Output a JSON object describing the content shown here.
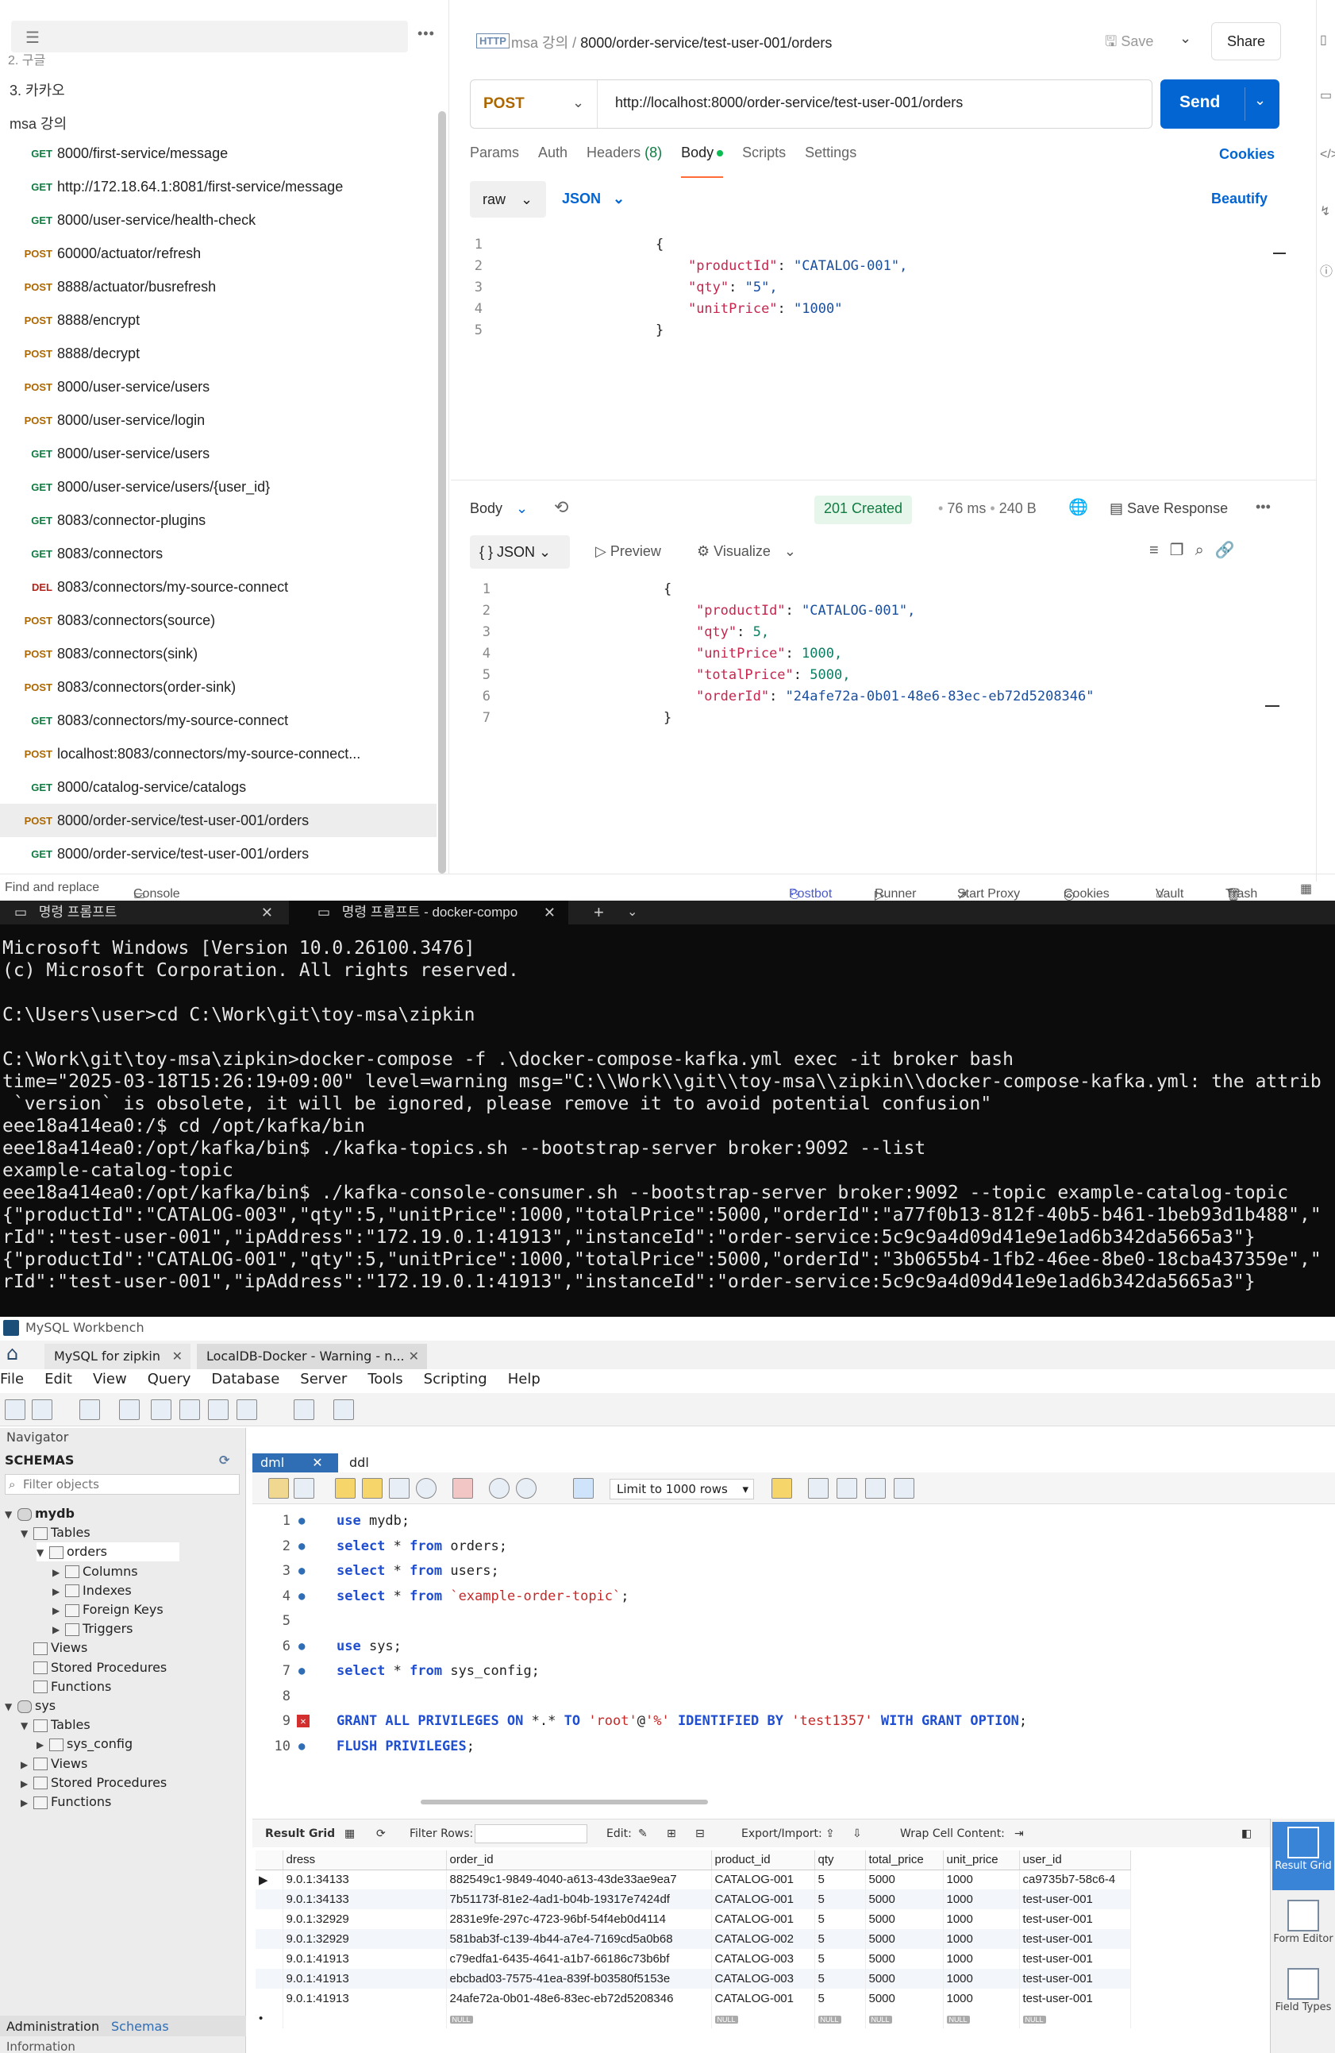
{
  "postman": {
    "sidebar": {
      "clipped_item": "2. 구글",
      "folders": [
        "3. 카카오",
        "msa 강의"
      ],
      "items": [
        {
          "method": "GET",
          "url": "8000/first-service/message"
        },
        {
          "method": "GET",
          "url": "http://172.18.64.1:8081/first-service/message"
        },
        {
          "method": "GET",
          "url": "8000/user-service/health-check"
        },
        {
          "method": "POST",
          "url": "60000/actuator/refresh"
        },
        {
          "method": "POST",
          "url": "8888/actuator/busrefresh"
        },
        {
          "method": "POST",
          "url": "8888/encrypt"
        },
        {
          "method": "POST",
          "url": "8888/decrypt"
        },
        {
          "method": "POST",
          "url": "8000/user-service/users"
        },
        {
          "method": "POST",
          "url": "8000/user-service/login"
        },
        {
          "method": "GET",
          "url": "8000/user-service/users"
        },
        {
          "method": "GET",
          "url": "8000/user-service/users/{user_id}"
        },
        {
          "method": "GET",
          "url": "8083/connector-plugins"
        },
        {
          "method": "GET",
          "url": "8083/connectors"
        },
        {
          "method": "DEL",
          "url": "8083/connectors/my-source-connect"
        },
        {
          "method": "POST",
          "url": "8083/connectors(source)"
        },
        {
          "method": "POST",
          "url": "8083/connectors(sink)"
        },
        {
          "method": "POST",
          "url": "8083/connectors(order-sink)"
        },
        {
          "method": "GET",
          "url": "8083/connectors/my-source-connect"
        },
        {
          "method": "POST",
          "url": "localhost:8083/connectors/my-source-connect..."
        },
        {
          "method": "GET",
          "url": "8000/catalog-service/catalogs"
        },
        {
          "method": "POST",
          "url": "8000/order-service/test-user-001/orders"
        },
        {
          "method": "GET",
          "url": "8000/order-service/test-user-001/orders"
        }
      ]
    },
    "request": {
      "breadcrumb_parent": "msa 강의",
      "breadcrumb_sep": "/",
      "name": "8000/order-service/test-user-001/orders",
      "save_label": "Save",
      "share_label": "Share",
      "method": "POST",
      "url": "http://localhost:8000/order-service/test-user-001/orders",
      "send_label": "Send",
      "tabs": {
        "params": "Params",
        "auth": "Auth",
        "headers": "Headers",
        "headers_count": "(8)",
        "body": "Body",
        "scripts": "Scripts",
        "settings": "Settings"
      },
      "cookies_label": "Cookies",
      "body_mode": "raw",
      "body_lang": "JSON",
      "beautify_label": "Beautify",
      "body_lines": [
        "{",
        "    \"productId\": \"CATALOG-001\",",
        "    \"qty\": \"5\",",
        "    \"unitPrice\": \"1000\"",
        "}"
      ]
    },
    "response": {
      "body_label": "Body",
      "status": "201 Created",
      "time": "76 ms",
      "size": "240 B",
      "save_response": "Save Response",
      "format": "{ } JSON",
      "preview": "Preview",
      "visualize": "Visualize",
      "lines": [
        "{",
        "    \"productId\": \"CATALOG-001\",",
        "    \"qty\": 5,",
        "    \"unitPrice\": 1000,",
        "    \"totalPrice\": 5000,",
        "    \"orderId\": \"24afe72a-0b01-48e6-83ec-eb72d5208346\"",
        "}"
      ]
    },
    "footer": {
      "find_replace": "Find and replace",
      "console": "Console",
      "postbot": "Postbot",
      "runner": "Runner",
      "start_proxy": "Start Proxy",
      "cookies": "Cookies",
      "vault": "Vault",
      "trash": "Trash"
    }
  },
  "terminal": {
    "tab1": "명령 프롬프트",
    "tab2": "명령 프롬프트 - docker-compo",
    "lines": [
      "Microsoft Windows [Version 10.0.26100.3476]",
      "(c) Microsoft Corporation. All rights reserved.",
      "",
      "C:\\Users\\user>cd C:\\Work\\git\\toy-msa\\zipkin",
      "",
      "C:\\Work\\git\\toy-msa\\zipkin>docker-compose -f .\\docker-compose-kafka.yml exec -it broker bash",
      "time=\"2025-03-18T15:26:19+09:00\" level=warning msg=\"C:\\\\Work\\\\git\\\\toy-msa\\\\zipkin\\\\docker-compose-kafka.yml: the attrib",
      " `version` is obsolete, it will be ignored, please remove it to avoid potential confusion\"",
      "eee18a414ea0:/$ cd /opt/kafka/bin",
      "eee18a414ea0:/opt/kafka/bin$ ./kafka-topics.sh --bootstrap-server broker:9092 --list",
      "example-catalog-topic",
      "eee18a414ea0:/opt/kafka/bin$ ./kafka-console-consumer.sh --bootstrap-server broker:9092 --topic example-catalog-topic",
      "{\"productId\":\"CATALOG-003\",\"qty\":5,\"unitPrice\":1000,\"totalPrice\":5000,\"orderId\":\"a77f0b13-812f-40b5-b461-1beb93d1b488\",\"",
      "rId\":\"test-user-001\",\"ipAddress\":\"172.19.0.1:41913\",\"instanceId\":\"order-service:5c9c9a4d09d41e9e1ad6b342da5665a3\"}",
      "{\"productId\":\"CATALOG-001\",\"qty\":5,\"unitPrice\":1000,\"totalPrice\":5000,\"orderId\":\"3b0655b4-1fb2-46ee-8be0-18cba437359e\",\"",
      "rId\":\"test-user-001\",\"ipAddress\":\"172.19.0.1:41913\",\"instanceId\":\"order-service:5c9c9a4d09d41e9e1ad6b342da5665a3\"}"
    ]
  },
  "workbench": {
    "title": "MySQL Workbench",
    "tab1": "MySQL for zipkin",
    "tab2": "LocalDB-Docker - Warning - n...",
    "menu": [
      "File",
      "Edit",
      "View",
      "Query",
      "Database",
      "Server",
      "Tools",
      "Scripting",
      "Help"
    ],
    "navigator_label": "Navigator",
    "schemas_label": "SCHEMAS",
    "filter_placeholder": "Filter objects",
    "tree": [
      {
        "label": "mydb",
        "level": 0,
        "arrow": "▼",
        "icon": "db",
        "bold": true
      },
      {
        "label": "Tables",
        "level": 1,
        "arrow": "▼",
        "icon": "folder"
      },
      {
        "label": "orders",
        "level": 2,
        "arrow": "▼",
        "icon": "table",
        "selected": true
      },
      {
        "label": "Columns",
        "level": 3,
        "arrow": "▶",
        "icon": "folder"
      },
      {
        "label": "Indexes",
        "level": 3,
        "arrow": "▶",
        "icon": "folder"
      },
      {
        "label": "Foreign Keys",
        "level": 3,
        "arrow": "▶",
        "icon": "folder"
      },
      {
        "label": "Triggers",
        "level": 3,
        "arrow": "▶",
        "icon": "folder"
      },
      {
        "label": "Views",
        "level": 1,
        "arrow": "",
        "icon": "folder"
      },
      {
        "label": "Stored Procedures",
        "level": 1,
        "arrow": "",
        "icon": "folder"
      },
      {
        "label": "Functions",
        "level": 1,
        "arrow": "",
        "icon": "folder"
      },
      {
        "label": "sys",
        "level": 0,
        "arrow": "▼",
        "icon": "db"
      },
      {
        "label": "Tables",
        "level": 1,
        "arrow": "▼",
        "icon": "folder"
      },
      {
        "label": "sys_config",
        "level": 2,
        "arrow": "▶",
        "icon": "table"
      },
      {
        "label": "Views",
        "level": 1,
        "arrow": "▶",
        "icon": "folder"
      },
      {
        "label": "Stored Procedures",
        "level": 1,
        "arrow": "▶",
        "icon": "folder"
      },
      {
        "label": "Functions",
        "level": 1,
        "arrow": "▶",
        "icon": "folder"
      }
    ],
    "nav_tabs": {
      "admin": "Administration",
      "schemas": "Schemas"
    },
    "info_label": "Information",
    "editor_tabs": {
      "dml": "dml",
      "ddl": "ddl"
    },
    "limit_rows": "Limit to 1000 rows",
    "sql_lines": [
      {
        "n": "1",
        "marker": "dot",
        "tokens": [
          [
            "kw",
            "use "
          ],
          [
            "idn",
            "mydb;"
          ]
        ]
      },
      {
        "n": "2",
        "marker": "dot",
        "tokens": [
          [
            "kw",
            "select "
          ],
          [
            "idn",
            "* "
          ],
          [
            "kw",
            "from "
          ],
          [
            "idn",
            "orders;"
          ]
        ]
      },
      {
        "n": "3",
        "marker": "dot",
        "tokens": [
          [
            "kw",
            "select "
          ],
          [
            "idn",
            "* "
          ],
          [
            "kw",
            "from "
          ],
          [
            "idn",
            "users;"
          ]
        ]
      },
      {
        "n": "4",
        "marker": "dot",
        "tokens": [
          [
            "kw",
            "select "
          ],
          [
            "idn",
            "* "
          ],
          [
            "kw",
            "from "
          ],
          [
            "str",
            "`example-order-topic`"
          ],
          [
            "idn",
            ";"
          ]
        ]
      },
      {
        "n": "5",
        "marker": "",
        "tokens": []
      },
      {
        "n": "6",
        "marker": "dot",
        "tokens": [
          [
            "kw",
            "use "
          ],
          [
            "idn",
            "sys;"
          ]
        ]
      },
      {
        "n": "7",
        "marker": "dot",
        "tokens": [
          [
            "kw",
            "select "
          ],
          [
            "idn",
            "* "
          ],
          [
            "kw",
            "from "
          ],
          [
            "idn",
            "sys_config;"
          ]
        ]
      },
      {
        "n": "8",
        "marker": "",
        "tokens": []
      },
      {
        "n": "9",
        "marker": "err",
        "tokens": [
          [
            "kw",
            "GRANT ALL PRIVILEGES ON "
          ],
          [
            "idn",
            "*.* "
          ],
          [
            "kw",
            "TO "
          ],
          [
            "str",
            "'root'"
          ],
          [
            "idn",
            "@"
          ],
          [
            "str",
            "'%' "
          ],
          [
            "kw",
            "IDENTIFIED BY "
          ],
          [
            "str",
            "'test1357' "
          ],
          [
            "kw",
            "WITH GRANT OPTION"
          ],
          [
            "idn",
            ";"
          ]
        ]
      },
      {
        "n": "10",
        "marker": "dot",
        "tokens": [
          [
            "kw",
            "FLUSH PRIVILEGES"
          ],
          [
            "idn",
            ";"
          ]
        ]
      }
    ],
    "result_toolbar": {
      "result_grid": "Result Grid",
      "filter_rows": "Filter Rows:",
      "edit": "Edit:",
      "export_import": "Export/Import:",
      "wrap": "Wrap Cell Content:"
    },
    "grid": {
      "columns": [
        "dress",
        "order_id",
        "product_id",
        "qty",
        "total_price",
        "unit_price",
        "user_id"
      ],
      "rows": [
        [
          "9.0.1:34133",
          "882549c1-9849-4040-a613-43de33ae9ea7",
          "CATALOG-001",
          "5",
          "5000",
          "1000",
          "ca9735b7-58c6-4"
        ],
        [
          "9.0.1:34133",
          "7b51173f-81e2-4ad1-b04b-19317e7424df",
          "CATALOG-001",
          "5",
          "5000",
          "1000",
          "test-user-001"
        ],
        [
          "9.0.1:32929",
          "2831e9fe-297c-4723-96bf-54f4eb0d4114",
          "CATALOG-001",
          "5",
          "5000",
          "1000",
          "test-user-001"
        ],
        [
          "9.0.1:32929",
          "581bab3f-c139-4b44-a7e4-7169cd5a0b68",
          "CATALOG-002",
          "5",
          "5000",
          "1000",
          "test-user-001"
        ],
        [
          "9.0.1:41913",
          "c79edfa1-6435-4641-a1b7-66186c73b6bf",
          "CATALOG-003",
          "5",
          "5000",
          "1000",
          "test-user-001"
        ],
        [
          "9.0.1:41913",
          "ebcbad03-7575-41ea-839f-b03580f5153e",
          "CATALOG-003",
          "5",
          "5000",
          "1000",
          "test-user-001"
        ],
        [
          "9.0.1:41913",
          "24afe72a-0b01-48e6-83ec-eb72d5208346",
          "CATALOG-001",
          "5",
          "5000",
          "1000",
          "test-user-001"
        ]
      ],
      "null_label": "NULL"
    },
    "side_buttons": [
      "Result Grid",
      "Form Editor",
      "Field Types"
    ]
  }
}
